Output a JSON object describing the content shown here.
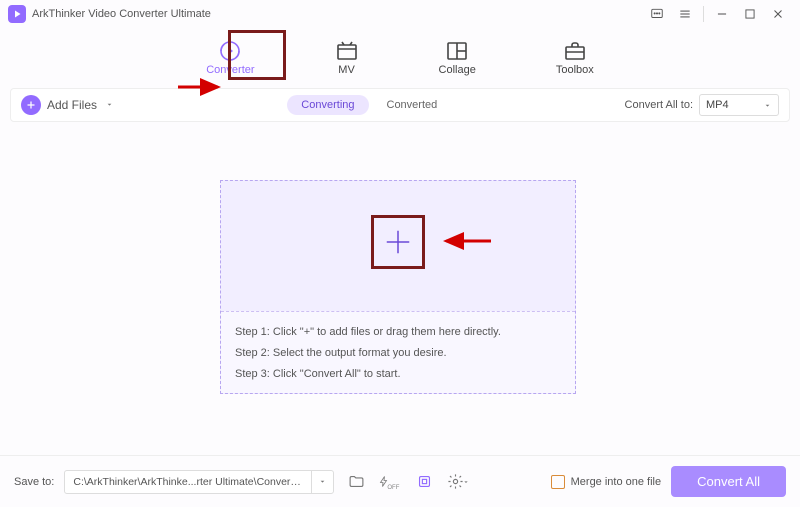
{
  "app": {
    "title": "ArkThinker Video Converter Ultimate"
  },
  "nav": {
    "items": [
      {
        "label": "Converter"
      },
      {
        "label": "MV"
      },
      {
        "label": "Collage"
      },
      {
        "label": "Toolbox"
      }
    ]
  },
  "toolbar": {
    "add_files": "Add Files",
    "converting": "Converting",
    "converted": "Converted",
    "convert_all_to": "Convert All to:",
    "format": "MP4"
  },
  "dropzone": {
    "step1": "Step 1: Click \"+\" to add files or drag them here directly.",
    "step2": "Step 2: Select the output format you desire.",
    "step3": "Step 3: Click \"Convert All\" to start."
  },
  "bottom": {
    "save_to": "Save to:",
    "path": "C:\\ArkThinker\\ArkThinke...rter Ultimate\\Converted",
    "merge": "Merge into one file",
    "convert_all": "Convert All"
  }
}
